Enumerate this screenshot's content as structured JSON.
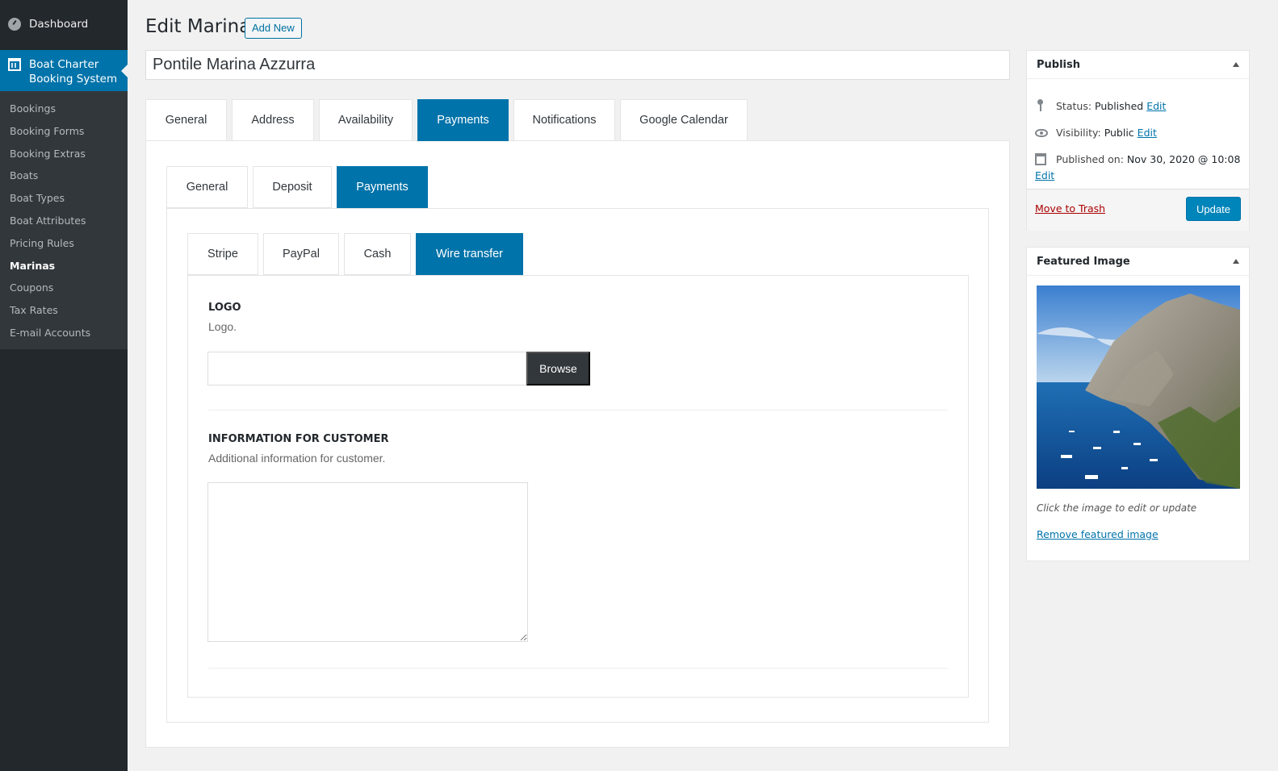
{
  "sidebar": {
    "dashboard": "Dashboard",
    "plugin": "Boat Charter Booking System",
    "submenu": [
      "Bookings",
      "Booking Forms",
      "Booking Extras",
      "Boats",
      "Boat Types",
      "Boat Attributes",
      "Pricing Rules",
      "Marinas",
      "Coupons",
      "Tax Rates",
      "E-mail Accounts"
    ],
    "current": "Marinas"
  },
  "header": {
    "title": "Edit Marina",
    "add_new": "Add New"
  },
  "post_title": "Pontile Marina Azzurra",
  "tabs_main": [
    "General",
    "Address",
    "Availability",
    "Payments",
    "Notifications",
    "Google Calendar"
  ],
  "tabs_payments": [
    "General",
    "Deposit",
    "Payments"
  ],
  "tabs_methods": [
    "Stripe",
    "PayPal",
    "Cash",
    "Wire transfer"
  ],
  "wire": {
    "logo_title": "LOGO",
    "logo_desc": "Logo.",
    "browse": "Browse",
    "info_title": "INFORMATION FOR CUSTOMER",
    "info_desc": "Additional information for customer."
  },
  "publish": {
    "title": "Publish",
    "status_label": "Status:",
    "status_value": "Published",
    "visibility_label": "Visibility:",
    "visibility_value": "Public",
    "published_label": "Published on:",
    "published_value": "Nov 30, 2020 @ 10:08",
    "edit": "Edit",
    "trash": "Move to Trash",
    "update": "Update"
  },
  "featured": {
    "title": "Featured Image",
    "caption": "Click the image to edit or update",
    "remove": "Remove featured image"
  },
  "colors": {
    "accent": "#0073aa",
    "sidebar": "#23282d",
    "submenu": "#32373c"
  }
}
